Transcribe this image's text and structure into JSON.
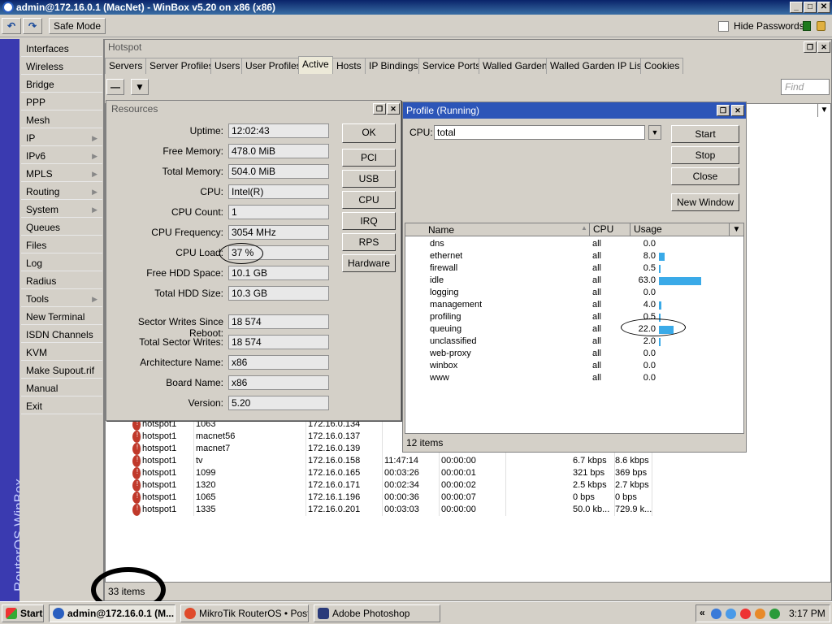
{
  "window": {
    "title": "admin@172.16.0.1 (MacNet) - WinBox v5.20 on x86 (x86)",
    "min": "_",
    "max": "□",
    "close": "✕"
  },
  "toolbar": {
    "undo": "↶",
    "redo": "↷",
    "safe_mode": "Safe Mode",
    "hide_passwords": "Hide Passwords"
  },
  "sidebar": {
    "brand": "RouterOS WinBox",
    "items": [
      {
        "label": "Interfaces"
      },
      {
        "label": "Wireless"
      },
      {
        "label": "Bridge"
      },
      {
        "label": "PPP"
      },
      {
        "label": "Mesh"
      },
      {
        "label": "IP"
      },
      {
        "label": "IPv6"
      },
      {
        "label": "MPLS"
      },
      {
        "label": "Routing"
      },
      {
        "label": "System"
      },
      {
        "label": "Queues"
      },
      {
        "label": "Files"
      },
      {
        "label": "Log"
      },
      {
        "label": "Radius"
      },
      {
        "label": "Tools"
      },
      {
        "label": "New Terminal"
      },
      {
        "label": "ISDN Channels"
      },
      {
        "label": "KVM"
      },
      {
        "label": "Make Supout.rif"
      },
      {
        "label": "Manual"
      },
      {
        "label": "Exit"
      }
    ],
    "arrow": "▶"
  },
  "hotspot": {
    "title": "Hotspot",
    "tabs": [
      "Servers",
      "Server Profiles",
      "Users",
      "User Profiles",
      "Active",
      "Hosts",
      "IP Bindings",
      "Service Ports",
      "Walled Garden",
      "Walled Garden IP List",
      "Cookies"
    ],
    "find_placeholder": "Find",
    "rows": [
      [
        "hotspot1",
        "1063",
        "172.16.0.134",
        "",
        "",
        "",
        ""
      ],
      [
        "hotspot1",
        "macnet56",
        "172.16.0.137",
        "",
        "",
        "",
        ""
      ],
      [
        "hotspot1",
        "macnet7",
        "172.16.0.139",
        "",
        "",
        "",
        ""
      ],
      [
        "hotspot1",
        "tv",
        "172.16.0.158",
        "11:47:14",
        "00:00:00",
        "6.7 kbps",
        "8.6 kbps"
      ],
      [
        "hotspot1",
        "1099",
        "172.16.0.165",
        "00:03:26",
        "00:00:01",
        "321 bps",
        "369 bps"
      ],
      [
        "hotspot1",
        "1320",
        "172.16.0.171",
        "00:02:34",
        "00:00:02",
        "2.5 kbps",
        "2.7 kbps"
      ],
      [
        "hotspot1",
        "1065",
        "172.16.1.196",
        "00:00:36",
        "00:00:07",
        "0 bps",
        "0 bps"
      ],
      [
        "hotspot1",
        "1335",
        "172.16.0.201",
        "00:03:03",
        "00:00:00",
        "50.0 kb...",
        "729.9 k..."
      ]
    ],
    "status": "33 items"
  },
  "resources": {
    "title": "Resources",
    "fields": [
      {
        "label": "Uptime:",
        "value": "12:02:43"
      },
      {
        "label": "Free Memory:",
        "value": "478.0 MiB"
      },
      {
        "label": "Total Memory:",
        "value": "504.0 MiB"
      },
      {
        "label": "CPU:",
        "value": "Intel(R)"
      },
      {
        "label": "CPU Count:",
        "value": "1"
      },
      {
        "label": "CPU Frequency:",
        "value": "3054 MHz"
      },
      {
        "label": "CPU Load:",
        "value": "37 %"
      },
      {
        "label": "Free HDD Space:",
        "value": "10.1 GB"
      },
      {
        "label": "Total HDD Size:",
        "value": "10.3 GB"
      },
      {
        "label": "Sector Writes Since Reboot:",
        "value": "18 574"
      },
      {
        "label": "Total Sector Writes:",
        "value": "18 574"
      },
      {
        "label": "Architecture Name:",
        "value": "x86"
      },
      {
        "label": "Board Name:",
        "value": "x86"
      },
      {
        "label": "Version:",
        "value": "5.20"
      }
    ],
    "buttons": [
      "OK",
      "PCI",
      "USB",
      "CPU",
      "IRQ",
      "RPS",
      "Hardware"
    ]
  },
  "profile": {
    "title": "Profile (Running)",
    "cpu_label": "CPU:",
    "cpu_value": "total",
    "buttons": [
      "Start",
      "Stop",
      "Close",
      "New Window"
    ],
    "columns": [
      "Name",
      "CPU",
      "Usage"
    ],
    "rows": [
      {
        "name": "dns",
        "cpu": "all",
        "usage": "0.0",
        "pct": 0
      },
      {
        "name": "ethernet",
        "cpu": "all",
        "usage": "8.0",
        "pct": 8
      },
      {
        "name": "firewall",
        "cpu": "all",
        "usage": "0.5",
        "pct": 0.5
      },
      {
        "name": "idle",
        "cpu": "all",
        "usage": "63.0",
        "pct": 63
      },
      {
        "name": "logging",
        "cpu": "all",
        "usage": "0.0",
        "pct": 0
      },
      {
        "name": "management",
        "cpu": "all",
        "usage": "4.0",
        "pct": 4
      },
      {
        "name": "profiling",
        "cpu": "all",
        "usage": "0.5",
        "pct": 0.5
      },
      {
        "name": "queuing",
        "cpu": "all",
        "usage": "22.0",
        "pct": 22
      },
      {
        "name": "unclassified",
        "cpu": "all",
        "usage": "2.0",
        "pct": 2
      },
      {
        "name": "web-proxy",
        "cpu": "all",
        "usage": "0.0",
        "pct": 0
      },
      {
        "name": "winbox",
        "cpu": "all",
        "usage": "0.0",
        "pct": 0
      },
      {
        "name": "www",
        "cpu": "all",
        "usage": "0.0",
        "pct": 0
      }
    ],
    "status": "12 items"
  },
  "taskbar": {
    "start": "Start",
    "tasks": [
      "admin@172.16.0.1 (M...",
      "MikroTik RouterOS • Post...",
      "Adobe Photoshop"
    ],
    "clock": "3:17 PM",
    "chevron": "«"
  }
}
